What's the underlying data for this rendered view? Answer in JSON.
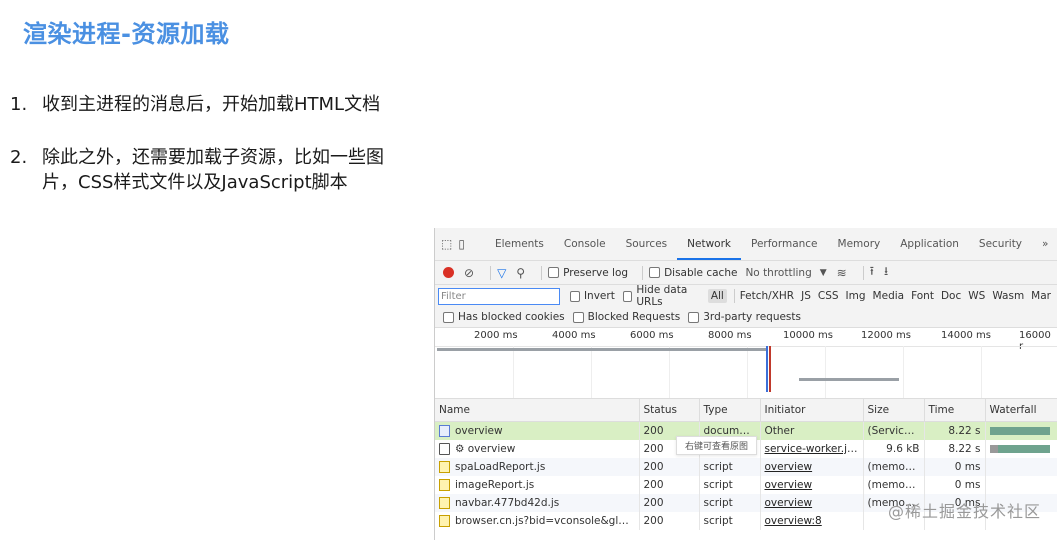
{
  "slide": {
    "title": "渲染进程-资源加载",
    "points": [
      {
        "num": "1.",
        "text": "收到主进程的消息后，开始加载HTML文档"
      },
      {
        "num": "2.",
        "text": "除此之外，还需要加载子资源，比如一些图片，CSS样式文件以及JavaScript脚本"
      }
    ]
  },
  "devtools": {
    "tabs": [
      "Elements",
      "Console",
      "Sources",
      "Network",
      "Performance",
      "Memory",
      "Application",
      "Security"
    ],
    "more": "»",
    "active_tab": "Network",
    "toolbar": {
      "preserve_log": "Preserve log",
      "disable_cache": "Disable cache",
      "throttling": "No throttling"
    },
    "filter": {
      "placeholder": "Filter",
      "invert": "Invert",
      "hide_data_urls": "Hide data URLs",
      "types": [
        "All",
        "Fetch/XHR",
        "JS",
        "CSS",
        "Img",
        "Media",
        "Font",
        "Doc",
        "WS",
        "Wasm",
        "Mar"
      ],
      "has_blocked_cookies": "Has blocked cookies",
      "blocked_requests": "Blocked Requests",
      "third_party": "3rd-party requests"
    },
    "timeline": {
      "ticks": [
        "2000 ms",
        "4000 ms",
        "6000 ms",
        "8000 ms",
        "10000 ms",
        "12000 ms",
        "14000 ms",
        "16000 r"
      ]
    },
    "table": {
      "headers": [
        "Name",
        "Status",
        "Type",
        "Initiator",
        "Size",
        "Time",
        "Waterfall"
      ],
      "rows": [
        {
          "name": "overview",
          "status": "200",
          "type": "document",
          "initiator": "Other",
          "size": "(ServiceW...",
          "time": "8.22 s",
          "icon": "doc"
        },
        {
          "name": "⚙ overview",
          "status": "200",
          "type": "",
          "initiator": "service-worker.js:1",
          "size": "9.6 kB",
          "time": "8.22 s",
          "icon": "sw"
        },
        {
          "name": "spaLoadReport.js",
          "status": "200",
          "type": "script",
          "initiator": "overview",
          "size": "(memory ...",
          "time": "0 ms",
          "icon": "js"
        },
        {
          "name": "imageReport.js",
          "status": "200",
          "type": "script",
          "initiator": "overview",
          "size": "(memory ...",
          "time": "0 ms",
          "icon": "js"
        },
        {
          "name": "navbar.477bd42d.js",
          "status": "200",
          "type": "script",
          "initiator": "overview",
          "size": "(memory ...",
          "time": "0 ms",
          "icon": "js"
        },
        {
          "name": "browser.cn.js?bid=vconsole&globalN...",
          "status": "200",
          "type": "script",
          "initiator": "overview:8",
          "size": "",
          "time": "",
          "icon": "js"
        }
      ]
    },
    "tooltip": "右键可查看原图"
  },
  "watermark": "@稀土掘金技术社区",
  "colors": {
    "title": "#4a90e2",
    "selected_row": "#d9efc4",
    "record": "#d93025"
  }
}
